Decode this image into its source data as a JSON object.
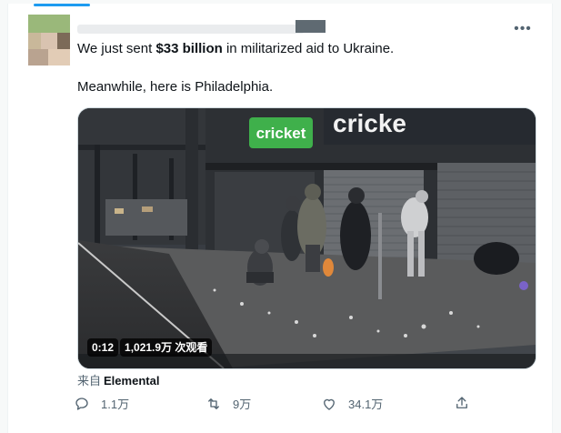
{
  "tweet": {
    "text_line1_pre": "We just sent ",
    "text_line1_bold": "$33 billion",
    "text_line1_post": " in militarized aid to Ukraine.",
    "text_line2": "Meanwhile, here is Philadelphia.",
    "more_label": "•••"
  },
  "video": {
    "sign_cricket": "cricket",
    "sign_store": "cricke",
    "duration": "0:12",
    "views": "1,021.9万 次观看"
  },
  "source": {
    "prefix": "来自",
    "name": "Elemental"
  },
  "actions": {
    "replies": "1.1万",
    "retweets": "9万",
    "likes": "34.1万"
  },
  "colors": {
    "accent": "#1d9bf0",
    "muted": "#536471",
    "text": "#0f1419",
    "cricket_green": "#3fb04b"
  }
}
